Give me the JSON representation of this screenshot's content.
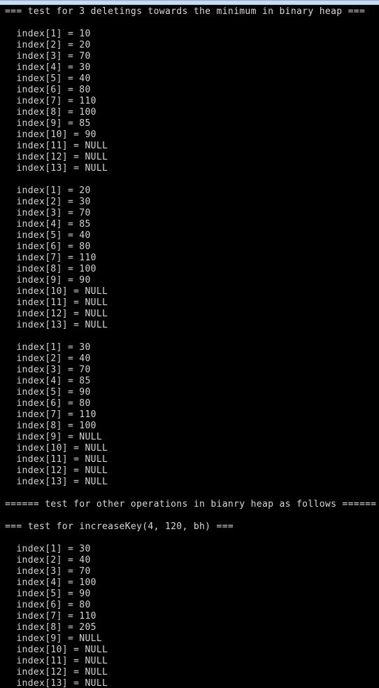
{
  "window": {
    "chrome_strip_colors": [
      "#96b0cc",
      "#d2e2f2",
      "#b4cde4"
    ],
    "background": "#000000",
    "foreground": "#d4d4d4"
  },
  "terminal": {
    "lines": [
      "=== test for 3 deletings towards the minimum in binary heap ===",
      "",
      "  index[1] = 10",
      "  index[2] = 20",
      "  index[3] = 70",
      "  index[4] = 30",
      "  index[5] = 40",
      "  index[6] = 80",
      "  index[7] = 110",
      "  index[8] = 100",
      "  index[9] = 85",
      "  index[10] = 90",
      "  index[11] = NULL",
      "  index[12] = NULL",
      "  index[13] = NULL",
      "",
      "  index[1] = 20",
      "  index[2] = 30",
      "  index[3] = 70",
      "  index[4] = 85",
      "  index[5] = 40",
      "  index[6] = 80",
      "  index[7] = 110",
      "  index[8] = 100",
      "  index[9] = 90",
      "  index[10] = NULL",
      "  index[11] = NULL",
      "  index[12] = NULL",
      "  index[13] = NULL",
      "",
      "  index[1] = 30",
      "  index[2] = 40",
      "  index[3] = 70",
      "  index[4] = 85",
      "  index[5] = 90",
      "  index[6] = 80",
      "  index[7] = 110",
      "  index[8] = 100",
      "  index[9] = NULL",
      "  index[10] = NULL",
      "  index[11] = NULL",
      "  index[12] = NULL",
      "  index[13] = NULL",
      "",
      "====== test for other operations in bianry heap as follows ======",
      "",
      "=== test for increaseKey(4, 120, bh) ===",
      "",
      "  index[1] = 30",
      "  index[2] = 40",
      "  index[3] = 70",
      "  index[4] = 100",
      "  index[5] = 90",
      "  index[6] = 80",
      "  index[7] = 110",
      "  index[8] = 205",
      "  index[9] = NULL",
      "  index[10] = NULL",
      "  index[11] = NULL",
      "  index[12] = NULL",
      "  index[13] = NULL"
    ]
  }
}
